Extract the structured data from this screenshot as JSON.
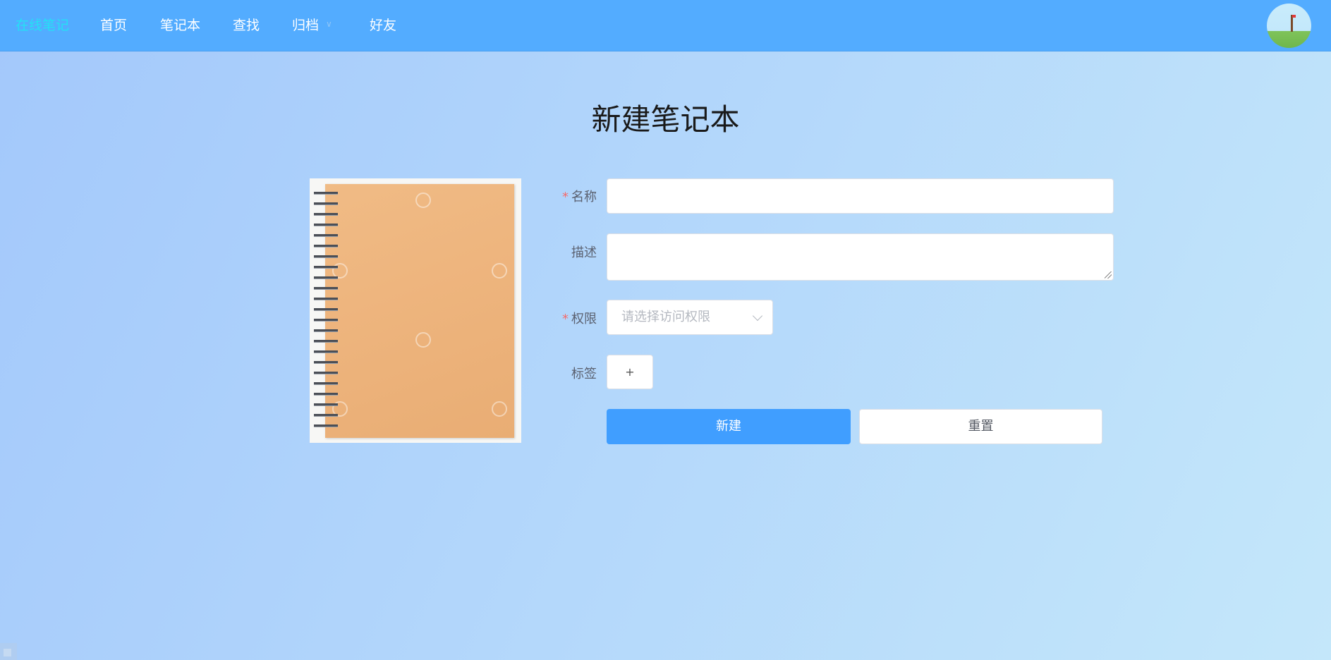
{
  "nav": {
    "brand": "在线笔记",
    "items": [
      {
        "label": "首页"
      },
      {
        "label": "笔记本"
      },
      {
        "label": "查找"
      },
      {
        "label": "归档",
        "has_dropdown": true
      },
      {
        "label": "好友"
      }
    ],
    "colors": {
      "bar": "#53acff",
      "brand_text": "#25e0f5",
      "item_text": "#ffffff"
    }
  },
  "page": {
    "title": "新建笔记本"
  },
  "form": {
    "name": {
      "label": "名称",
      "required_mark": "*",
      "value": ""
    },
    "description": {
      "label": "描述",
      "value": ""
    },
    "permission": {
      "label": "权限",
      "required_mark": "*",
      "placeholder": "请选择访问权限"
    },
    "tags": {
      "label": "标签",
      "add_button": "+"
    },
    "submit_label": "新建",
    "reset_label": "重置"
  },
  "colors": {
    "primary": "#409eff",
    "required": "#f56c6c",
    "border": "#dcdfe6"
  }
}
